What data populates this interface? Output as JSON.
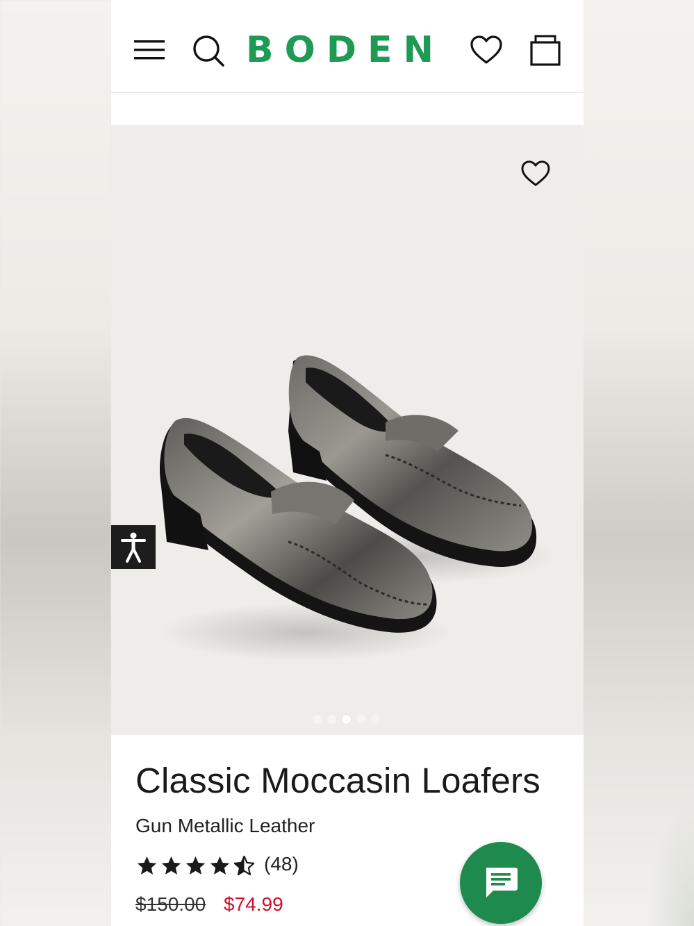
{
  "header": {
    "brand": "BODEN",
    "brand_color": "#1e9a55",
    "icons": [
      "menu-icon",
      "search-icon",
      "heart-icon",
      "bag-icon"
    ]
  },
  "hero": {
    "favorite_icon": "heart-icon",
    "carousel_total": 5,
    "carousel_active": 3
  },
  "accessibility": {
    "icon": "accessibility-person-icon"
  },
  "product": {
    "title": "Classic Moccasin Loafers",
    "color_name": "Gun Metallic Leather",
    "rating": 4.5,
    "review_count": "(48)",
    "price_original": "$150.00",
    "price_sale": "$74.99",
    "sale_color": "#c8102e"
  },
  "chat": {
    "icon": "chat-bubble-icon",
    "color": "#1e8a4d"
  }
}
